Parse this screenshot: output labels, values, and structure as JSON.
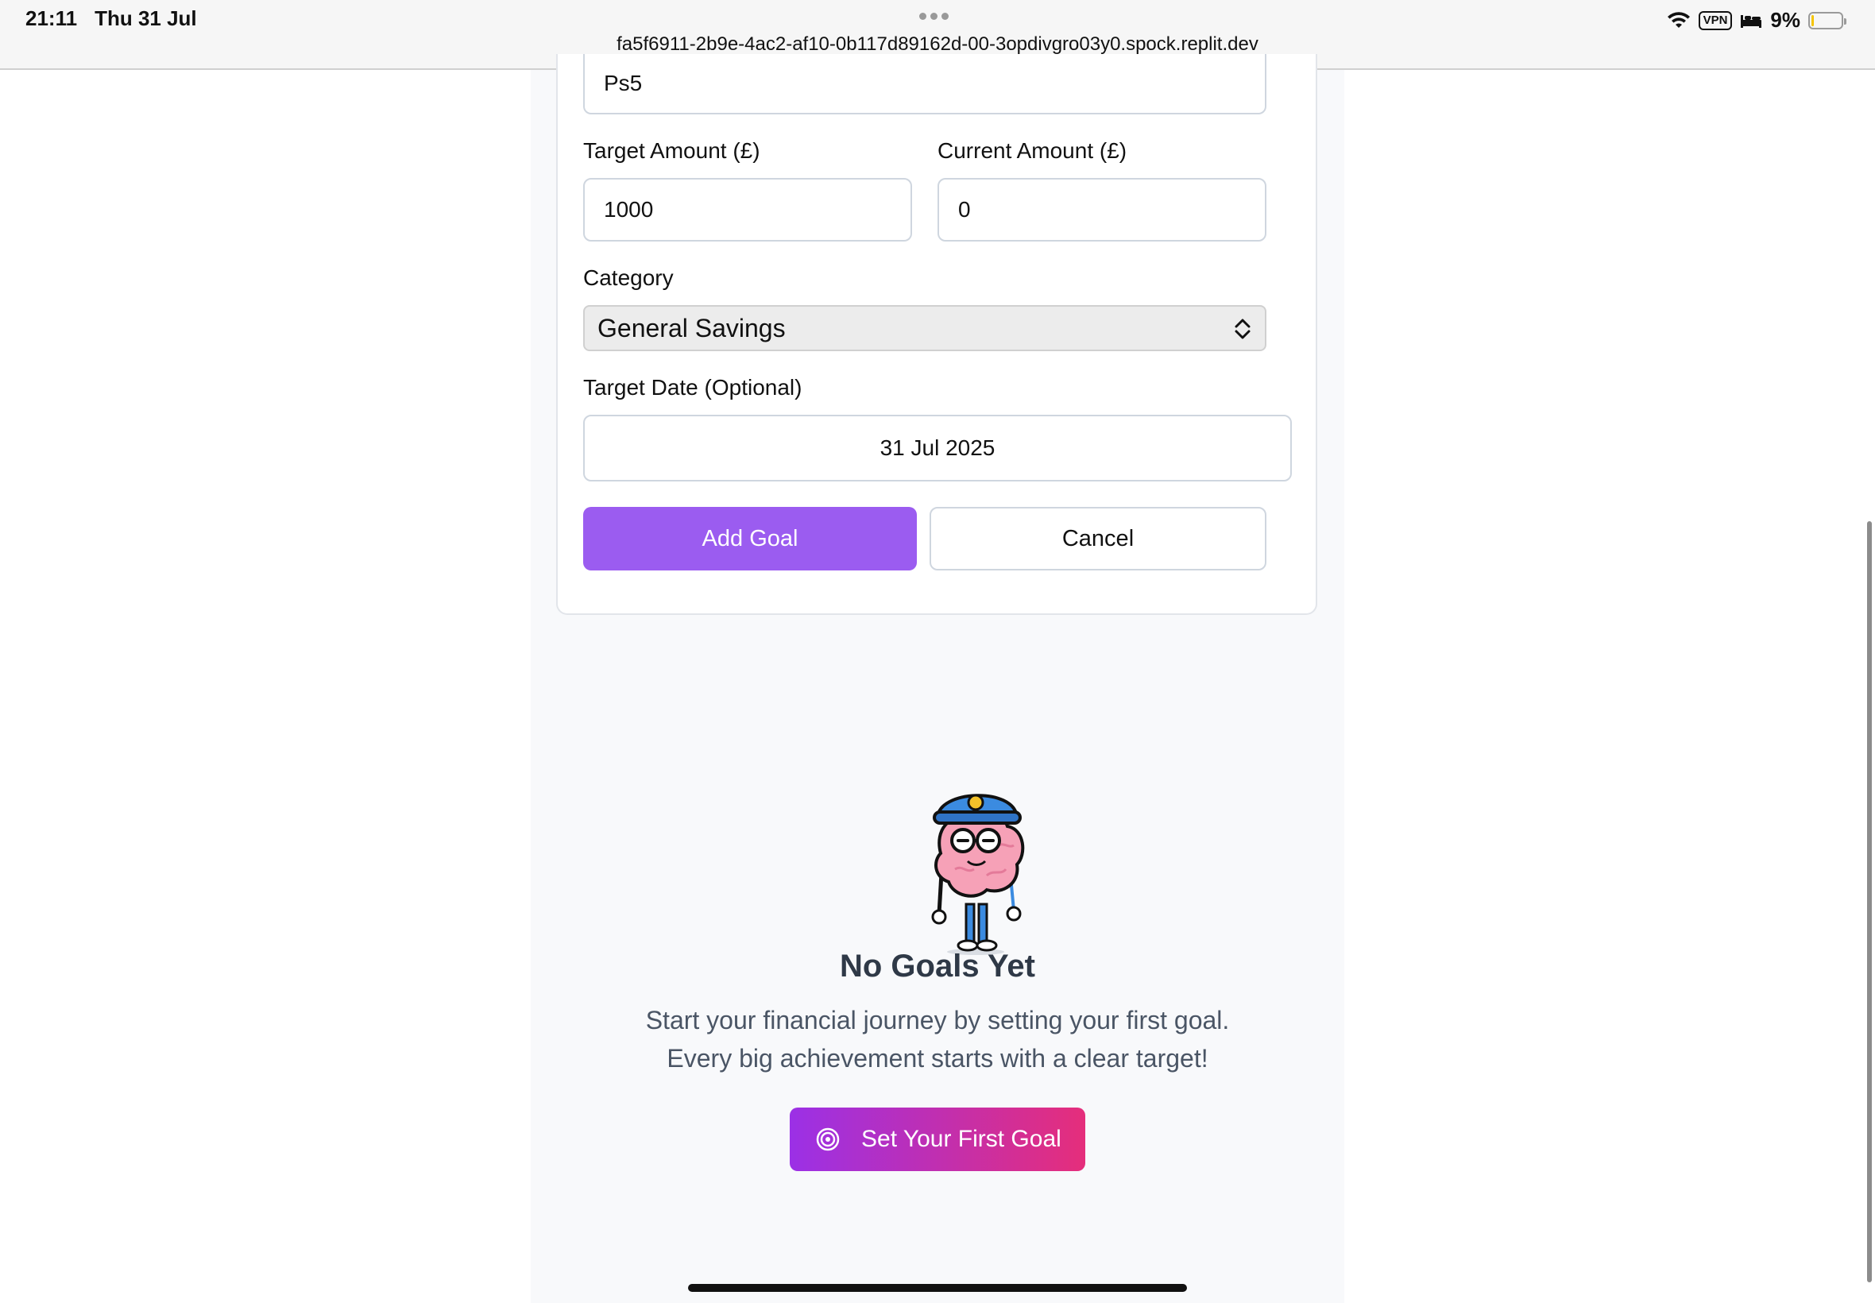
{
  "status_bar": {
    "time": "21:11",
    "date": "Thu 31 Jul",
    "url": "fa5f6911-2b9e-4ac2-af10-0b117d89162d-00-3opdivgro03y0.spock.replit.dev",
    "vpn_label": "VPN",
    "battery_percent": "9%",
    "battery_level": 0.09
  },
  "form": {
    "goal_name_value": "Ps5",
    "target_amount_label": "Target Amount (£)",
    "target_amount_value": "1000",
    "current_amount_label": "Current Amount (£)",
    "current_amount_value": "0",
    "category_label": "Category",
    "category_value": "General Savings",
    "target_date_label": "Target Date (Optional)",
    "target_date_value": "31 Jul 2025",
    "add_goal_label": "Add Goal",
    "cancel_label": "Cancel"
  },
  "empty_state": {
    "title": "No Goals Yet",
    "line1": "Start your financial journey by setting your first goal.",
    "line2": "Every big achievement starts with a clear target!",
    "cta_label": "Set Your First Goal"
  },
  "colors": {
    "primary": "#9b5cf0",
    "cta_gradient_start": "#9b30e6",
    "cta_gradient_end": "#e52e7b",
    "heading": "#2f3947"
  }
}
